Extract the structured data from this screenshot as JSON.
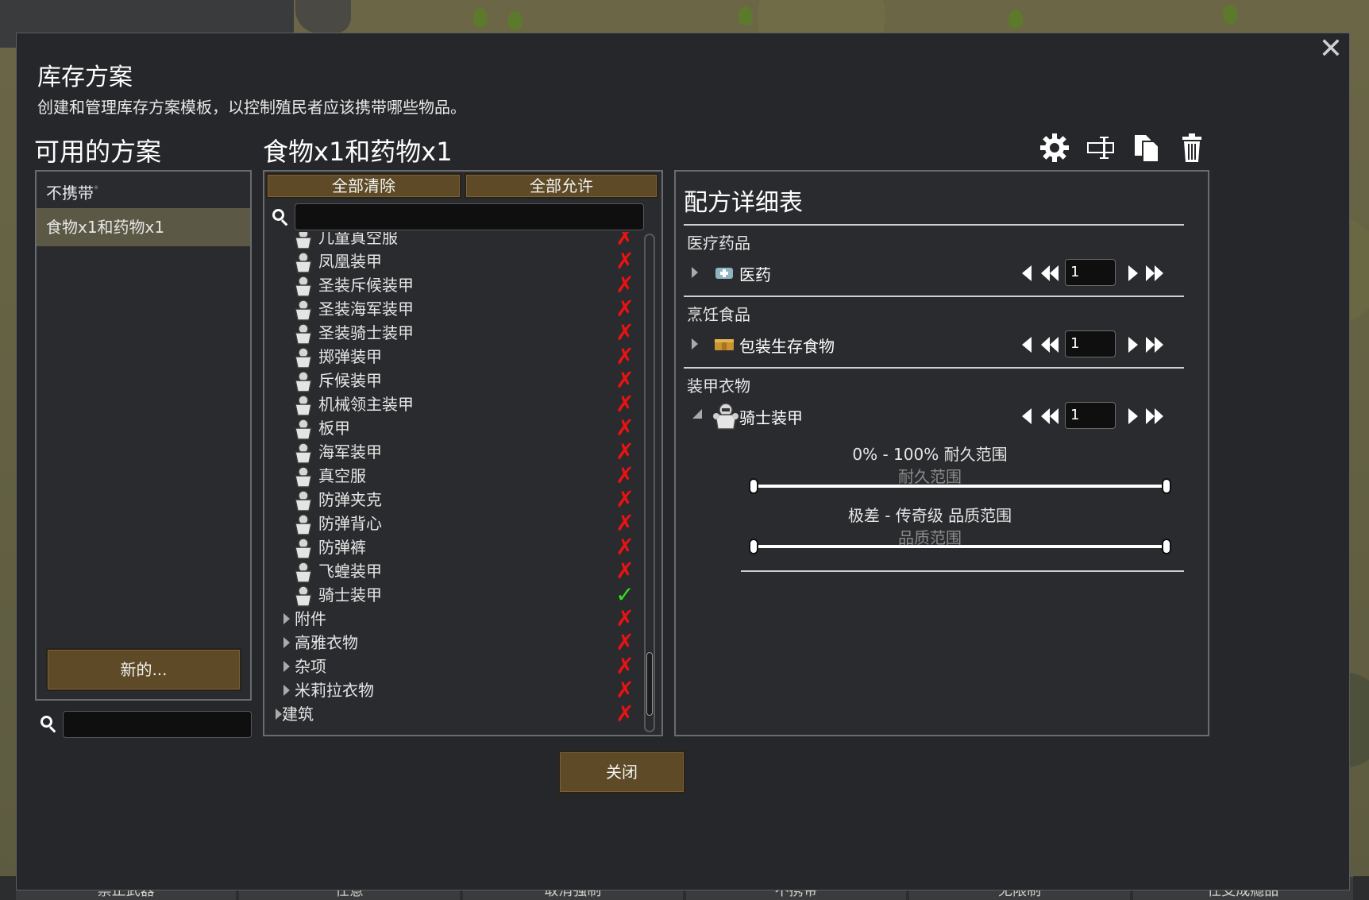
{
  "dialog": {
    "title": "库存方案",
    "description": "创建和管理库存方案模板，以控制殖民者应该携带哪些物品。",
    "close_button": "关闭"
  },
  "left_panel": {
    "heading": "可用的方案",
    "plans": [
      {
        "label": "不携带",
        "marker": "*",
        "active": false
      },
      {
        "label": "食物x1和药物x1",
        "active": true
      }
    ],
    "new_button": "新的...",
    "search_value": ""
  },
  "middle_panel": {
    "heading": "食物x1和药物x1",
    "clear_all_button": "全部清除",
    "allow_all_button": "全部允许",
    "search_value": "",
    "rows": [
      {
        "label": "儿童真空服",
        "icon": "apparel-icon",
        "state": "x",
        "kind": "item"
      },
      {
        "label": "凤凰装甲",
        "icon": "apparel-icon",
        "state": "x",
        "kind": "item"
      },
      {
        "label": "圣装斥候装甲",
        "icon": "apparel-icon",
        "state": "x",
        "kind": "item"
      },
      {
        "label": "圣装海军装甲",
        "icon": "apparel-icon",
        "state": "x",
        "kind": "item"
      },
      {
        "label": "圣装骑士装甲",
        "icon": "apparel-icon",
        "state": "x",
        "kind": "item"
      },
      {
        "label": "掷弹装甲",
        "icon": "apparel-icon",
        "state": "x",
        "kind": "item"
      },
      {
        "label": "斥候装甲",
        "icon": "apparel-icon",
        "state": "x",
        "kind": "item"
      },
      {
        "label": "机械领主装甲",
        "icon": "apparel-icon",
        "state": "x",
        "kind": "item"
      },
      {
        "label": "板甲",
        "icon": "apparel-icon",
        "state": "x",
        "kind": "item"
      },
      {
        "label": "海军装甲",
        "icon": "apparel-icon",
        "state": "x",
        "kind": "item"
      },
      {
        "label": "真空服",
        "icon": "apparel-icon",
        "state": "x",
        "kind": "item"
      },
      {
        "label": "防弹夹克",
        "icon": "apparel-icon",
        "state": "x",
        "kind": "item"
      },
      {
        "label": "防弹背心",
        "icon": "apparel-icon",
        "state": "x",
        "kind": "item"
      },
      {
        "label": "防弹裤",
        "icon": "apparel-icon",
        "state": "x",
        "kind": "item"
      },
      {
        "label": "飞蝗装甲",
        "icon": "apparel-icon",
        "state": "x",
        "kind": "item"
      },
      {
        "label": "骑士装甲",
        "icon": "apparel-icon",
        "state": "check",
        "kind": "item"
      },
      {
        "label": "附件",
        "state": "x",
        "kind": "category"
      },
      {
        "label": "高雅衣物",
        "state": "x",
        "kind": "category"
      },
      {
        "label": "杂项",
        "state": "x",
        "kind": "category"
      },
      {
        "label": "米莉拉衣物",
        "state": "x",
        "kind": "category"
      },
      {
        "label": "建筑",
        "state": "x",
        "kind": "top-category"
      }
    ]
  },
  "toolbar": {
    "icons": [
      "gear-icon",
      "rename-icon",
      "copy-icon",
      "trash-icon"
    ]
  },
  "detail_panel": {
    "heading": "配方详细表",
    "categories": [
      {
        "label": "医疗药品",
        "item": "医药",
        "count": "1",
        "icon": "medicine-icon"
      },
      {
        "label": "烹饪食品",
        "item": "包装生存食物",
        "count": "1",
        "icon": "food-package-icon"
      },
      {
        "label": "装甲衣物",
        "item": "骑士装甲",
        "count": "1",
        "icon": "armor-icon"
      }
    ],
    "hp_range": {
      "label": "0% - 100% 耐久范围",
      "sublabel": "耐久范围",
      "min": 0,
      "max": 1
    },
    "quality_range": {
      "label": "极差 - 传奇级 品质范围",
      "sublabel": "品质范围",
      "min": 0,
      "max": 1
    }
  },
  "bottom_bar": {
    "items": [
      "禁止武器",
      "任意",
      "取消强制",
      "不携带",
      "无限制",
      "任支成瘾品"
    ]
  },
  "colors": {
    "accent_button": "#5e4a26",
    "selected_row": "#5b5845",
    "disallowed": "#ee1111",
    "allowed": "#33dd22"
  }
}
